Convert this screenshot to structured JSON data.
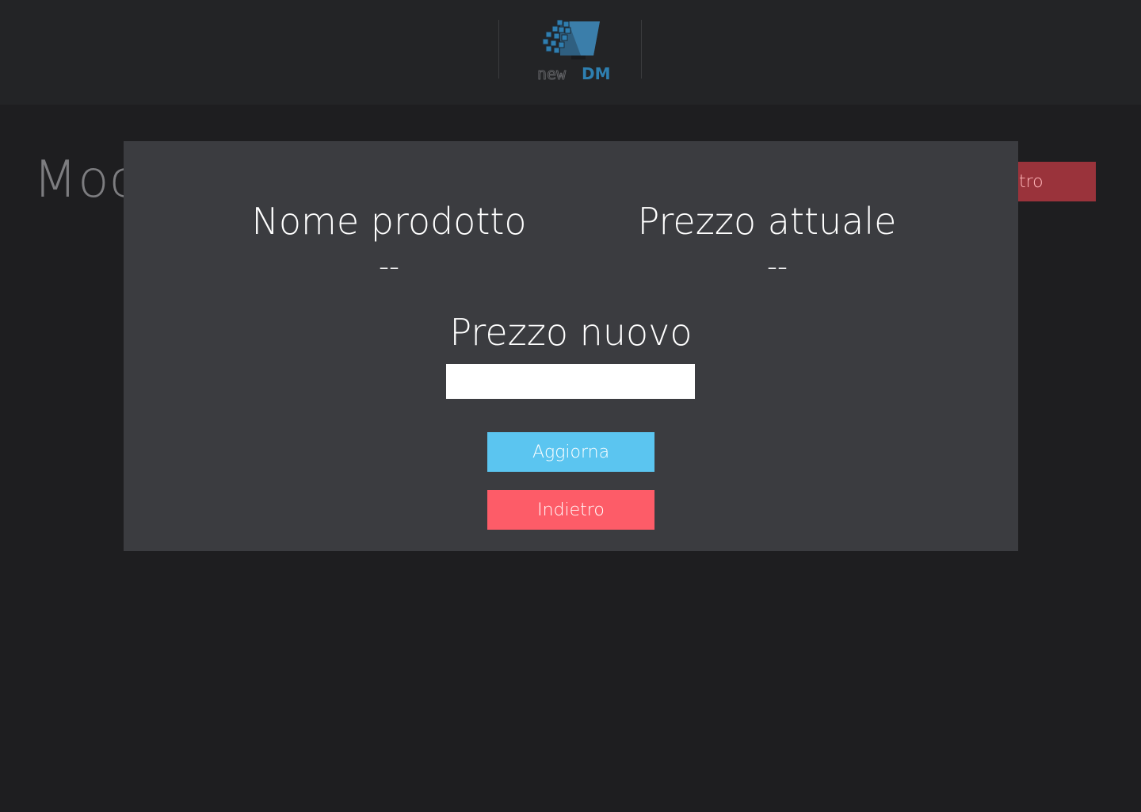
{
  "header": {
    "logo": {
      "icon": "newdm-monitor-logo",
      "text_light": "new",
      "text_bold": "DM",
      "brand_color": "#2e7fb0"
    }
  },
  "background_page": {
    "title_partial": "Moc",
    "back_button_partial": "etro"
  },
  "modal": {
    "product_name_label": "Nome prodotto",
    "product_name_value": "--",
    "current_price_label": "Prezzo attuale",
    "current_price_value": "--",
    "new_price_label": "Prezzo nuovo",
    "new_price_input_value": "",
    "update_button_label": "Aggiorna",
    "back_button_label": "Indietro"
  },
  "colors": {
    "update_button": "#5bc5f0",
    "back_button": "#fd5c68",
    "modal_background": "#3b3c40"
  }
}
